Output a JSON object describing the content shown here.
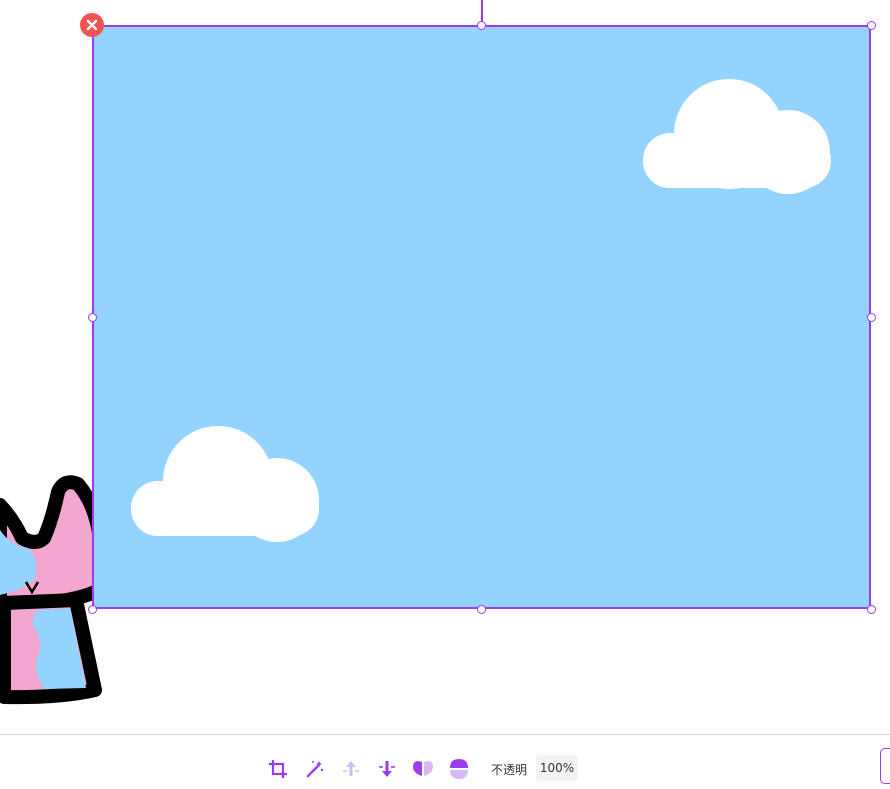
{
  "colors": {
    "accent": "#9a3cf0",
    "sky": "#94d3fd",
    "cloud": "#ffffff",
    "delete": "#f25252",
    "character_pink": "#f3a6cf",
    "character_blue": "#94d3fd",
    "outline": "#000000"
  },
  "canvas": {
    "delete_icon": "close-icon",
    "image_name": "sky-with-clouds"
  },
  "toolbar": {
    "tools": [
      {
        "name": "crop-icon"
      },
      {
        "name": "magic-wand-icon"
      },
      {
        "name": "bring-forward-icon"
      },
      {
        "name": "send-backward-icon"
      },
      {
        "name": "flip-horizontal-icon"
      },
      {
        "name": "flip-vertical-icon"
      }
    ],
    "opacity_label": "不透明",
    "opacity_value": "100%"
  }
}
